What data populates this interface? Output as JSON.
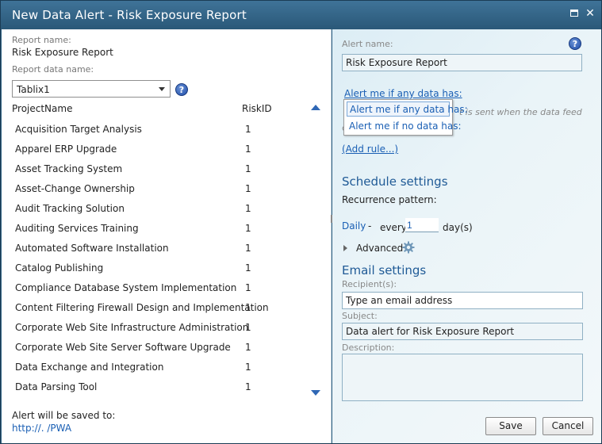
{
  "window": {
    "title": "New Data Alert - Risk Exposure Report"
  },
  "left": {
    "report_name_label": "Report name:",
    "report_name_value": "Risk Exposure Report",
    "report_data_name_label": "Report data name:",
    "data_name_selected": "Tablix1",
    "columns": {
      "project": "ProjectName",
      "risk": "RiskID"
    },
    "rows": [
      {
        "project": "Acquisition Target Analysis",
        "risk": "1"
      },
      {
        "project": "Apparel ERP Upgrade",
        "risk": "1"
      },
      {
        "project": "Asset Tracking System",
        "risk": "1"
      },
      {
        "project": "Asset-Change Ownership",
        "risk": "1"
      },
      {
        "project": "Audit Tracking Solution",
        "risk": "1"
      },
      {
        "project": "Auditing Services Training",
        "risk": "1"
      },
      {
        "project": "Automated Software Installation",
        "risk": "1"
      },
      {
        "project": "Catalog Publishing",
        "risk": "1"
      },
      {
        "project": "Compliance Database System Implementation",
        "risk": "1"
      },
      {
        "project": "Content Filtering Firewall Design and Implementation",
        "risk": "1"
      },
      {
        "project": "Corporate Web Site Infrastructure Administration",
        "risk": "1"
      },
      {
        "project": "Corporate Web Site Server Software Upgrade",
        "risk": "1"
      },
      {
        "project": "Data Exchange and Integration",
        "risk": "1"
      },
      {
        "project": "Data Parsing Tool",
        "risk": "1"
      }
    ],
    "saved_to_label": "Alert will be saved to:",
    "saved_to_link": "http://.            /PWA"
  },
  "right": {
    "alert_name_label": "Alert name:",
    "alert_name_value": "Risk Exposure Report",
    "alert_condition_link": "Alert me if any data has:",
    "condition_options": [
      "Alert me if any data has:",
      "Alert me if no data has:"
    ],
    "hidden_text": "t is sent when the data feed",
    "hidden_text_fragment": "c",
    "add_rule": "(Add rule...)",
    "schedule_heading": "Schedule settings",
    "recurrence_label": "Recurrence pattern:",
    "recurrence_value": "Daily",
    "recurrence_dash": "-",
    "every_label": "every",
    "every_value": "1",
    "every_unit": "day(s)",
    "advanced_label": "Advanced",
    "email_heading": "Email settings",
    "recipients_label": "Recipient(s):",
    "recipients_placeholder": "Type an email address",
    "subject_label": "Subject:",
    "subject_value": "Data alert for Risk Exposure Report",
    "description_label": "Description:",
    "description_value": ""
  },
  "buttons": {
    "save": "Save",
    "cancel": "Cancel"
  },
  "icons": {
    "maximize": "maximize-icon",
    "close": "close-icon",
    "help": "help-icon",
    "gear": "gear-icon",
    "dropdown": "chevron-down-icon"
  },
  "colors": {
    "title_bar": "#2f6183",
    "link": "#1a5fb4",
    "heading": "#1f5a96"
  }
}
